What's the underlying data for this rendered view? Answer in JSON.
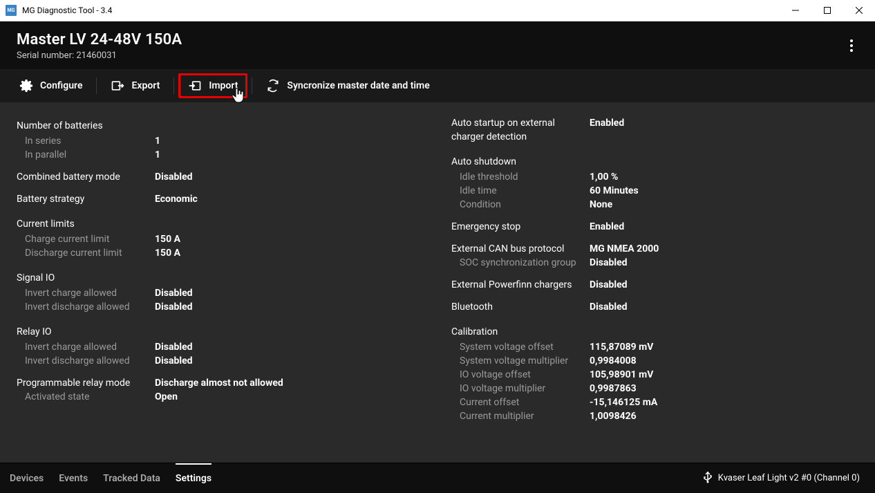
{
  "window": {
    "title": "MG Diagnostic Tool - 3.4"
  },
  "header": {
    "device_title": "Master LV 24-48V 150A",
    "serial_label": "Serial number: 21460031"
  },
  "toolbar": {
    "configure": "Configure",
    "export": "Export",
    "import": "Import",
    "sync": "Syncronize master date and time"
  },
  "left": {
    "num_batteries_title": "Number of batteries",
    "in_series_label": "In series",
    "in_series_value": "1",
    "in_parallel_label": "In parallel",
    "in_parallel_value": "1",
    "combined_mode_label": "Combined battery mode",
    "combined_mode_value": "Disabled",
    "battery_strategy_label": "Battery strategy",
    "battery_strategy_value": "Economic",
    "current_limits_title": "Current limits",
    "charge_limit_label": "Charge current limit",
    "charge_limit_value": "150 A",
    "discharge_limit_label": "Discharge current limit",
    "discharge_limit_value": "150 A",
    "signal_io_title": "Signal IO",
    "sio_invert_charge_label": "Invert charge allowed",
    "sio_invert_charge_value": "Disabled",
    "sio_invert_discharge_label": "Invert discharge allowed",
    "sio_invert_discharge_value": "Disabled",
    "relay_io_title": "Relay IO",
    "rio_invert_charge_label": "Invert charge allowed",
    "rio_invert_charge_value": "Disabled",
    "rio_invert_discharge_label": "Invert discharge allowed",
    "rio_invert_discharge_value": "Disabled",
    "prog_relay_label": "Programmable relay mode",
    "prog_relay_value": "Discharge almost not allowed",
    "activated_state_label": "Activated state",
    "activated_state_value": "Open"
  },
  "right": {
    "auto_startup_label": "Auto startup on external charger detection",
    "auto_startup_value": "Enabled",
    "auto_shutdown_title": "Auto shutdown",
    "idle_threshold_label": "Idle threshold",
    "idle_threshold_value": "1,00 %",
    "idle_time_label": "Idle time",
    "idle_time_value": "60 Minutes",
    "condition_label": "Condition",
    "condition_value": "None",
    "estop_label": "Emergency stop",
    "estop_value": "Enabled",
    "can_protocol_label": "External CAN bus protocol",
    "can_protocol_value": "MG NMEA 2000",
    "soc_sync_label": "SOC synchronization group",
    "soc_sync_value": "Disabled",
    "powerfinn_label": "External Powerfinn chargers",
    "powerfinn_value": "Disabled",
    "bluetooth_label": "Bluetooth",
    "bluetooth_value": "Disabled",
    "calibration_title": "Calibration",
    "sys_v_offset_label": "System voltage offset",
    "sys_v_offset_value": "115,87089 mV",
    "sys_v_mult_label": "System voltage multiplier",
    "sys_v_mult_value": "0,9984008",
    "io_v_offset_label": "IO voltage offset",
    "io_v_offset_value": "105,98901 mV",
    "io_v_mult_label": "IO voltage multiplier",
    "io_v_mult_value": "0,9987863",
    "current_offset_label": "Current offset",
    "current_offset_value": "-15,146125 mA",
    "current_mult_label": "Current multiplier",
    "current_mult_value": "1,0098426"
  },
  "tabs": {
    "devices": "Devices",
    "events": "Events",
    "tracked": "Tracked Data",
    "settings": "Settings"
  },
  "status": {
    "connection": "Kvaser Leaf Light v2 #0 (Channel 0)"
  }
}
